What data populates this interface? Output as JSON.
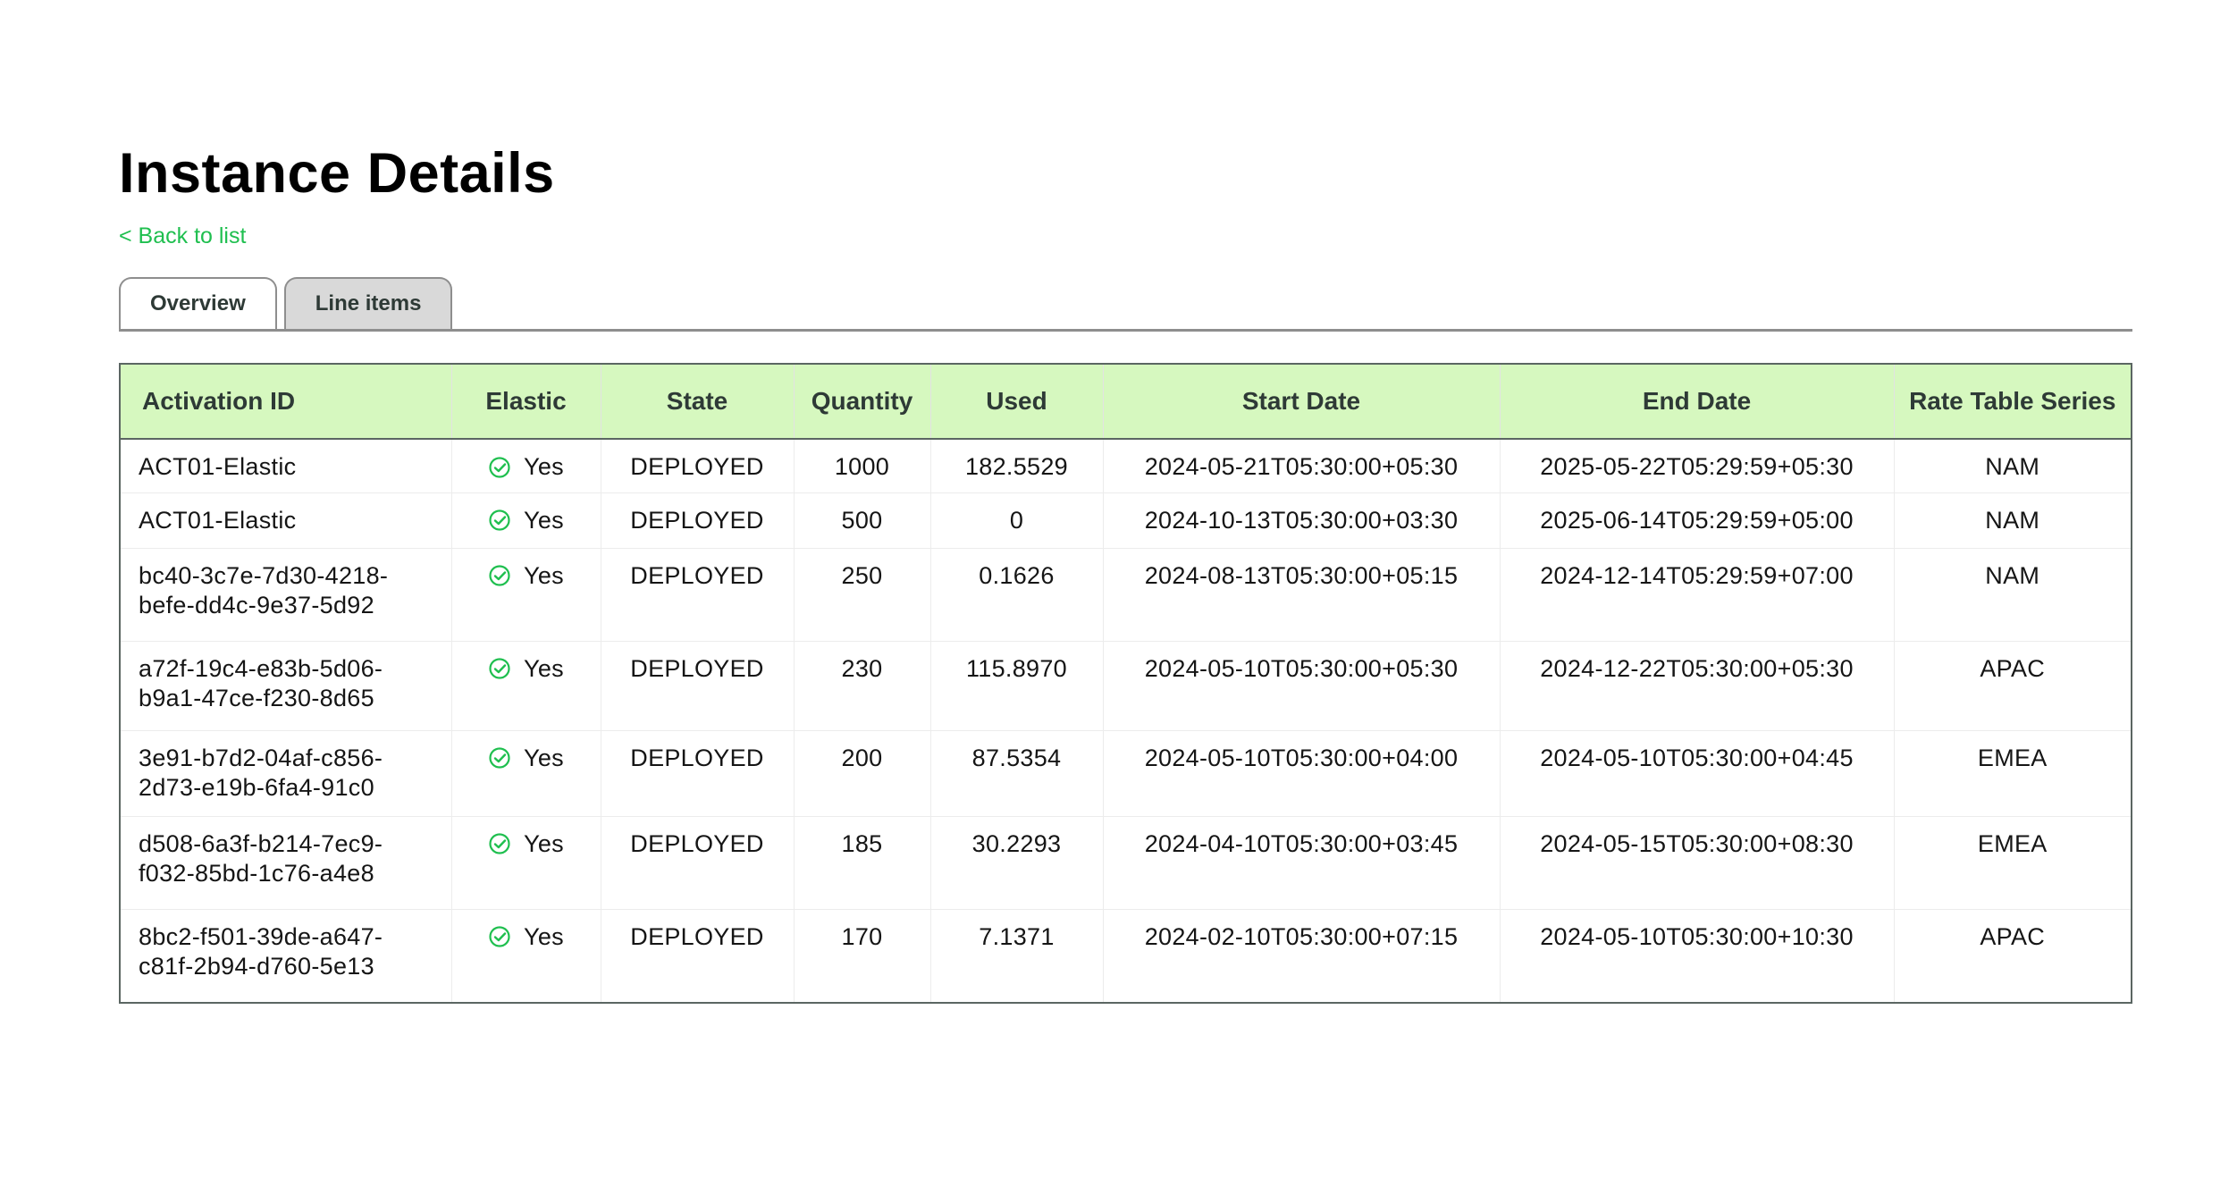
{
  "page": {
    "title": "Instance Details",
    "back_link": "< Back to list"
  },
  "tabs": [
    {
      "label": "Overview"
    },
    {
      "label": "Line items"
    }
  ],
  "table": {
    "columns": [
      "Activation ID",
      "Elastic",
      "State",
      "Quantity",
      "Used",
      "Start Date",
      "End Date",
      "Rate Table Series"
    ],
    "rows": [
      {
        "activation_id_1": "ACT01-Elastic",
        "activation_id_2": "",
        "elastic": "Yes",
        "state": "DEPLOYED",
        "quantity": "1000",
        "used": "182.5529",
        "start_date": "2024-05-21T05:30:00+05:30",
        "end_date": "2025-05-22T05:29:59+05:30",
        "rate_table_series": "NAM"
      },
      {
        "activation_id_1": "ACT01-Elastic",
        "activation_id_2": "",
        "elastic": "Yes",
        "state": "DEPLOYED",
        "quantity": "500",
        "used": "0",
        "start_date": "2024-10-13T05:30:00+03:30",
        "end_date": "2025-06-14T05:29:59+05:00",
        "rate_table_series": "NAM"
      },
      {
        "activation_id_1": "bc40-3c7e-7d30-4218-",
        "activation_id_2": "befe-dd4c-9e37-5d92",
        "elastic": "Yes",
        "state": "DEPLOYED",
        "quantity": "250",
        "used": "0.1626",
        "start_date": "2024-08-13T05:30:00+05:15",
        "end_date": "2024-12-14T05:29:59+07:00",
        "rate_table_series": "NAM"
      },
      {
        "activation_id_1": "a72f-19c4-e83b-5d06-",
        "activation_id_2": "b9a1-47ce-f230-8d65",
        "elastic": "Yes",
        "state": "DEPLOYED",
        "quantity": "230",
        "used": "115.8970",
        "start_date": "2024-05-10T05:30:00+05:30",
        "end_date": "2024-12-22T05:30:00+05:30",
        "rate_table_series": "APAC"
      },
      {
        "activation_id_1": "3e91-b7d2-04af-c856-",
        "activation_id_2": "2d73-e19b-6fa4-91c0",
        "elastic": "Yes",
        "state": "DEPLOYED",
        "quantity": "200",
        "used": "87.5354",
        "start_date": "2024-05-10T05:30:00+04:00",
        "end_date": "2024-05-10T05:30:00+04:45",
        "rate_table_series": "EMEA"
      },
      {
        "activation_id_1": "d508-6a3f-b214-7ec9-",
        "activation_id_2": "f032-85bd-1c76-a4e8",
        "elastic": "Yes",
        "state": "DEPLOYED",
        "quantity": "185",
        "used": "30.2293",
        "start_date": "2024-04-10T05:30:00+03:45",
        "end_date": "2024-05-15T05:30:00+08:30",
        "rate_table_series": "EMEA"
      },
      {
        "activation_id_1": "8bc2-f501-39de-a647-",
        "activation_id_2": "c81f-2b94-d760-5e13",
        "elastic": "Yes",
        "state": "DEPLOYED",
        "quantity": "170",
        "used": "7.1371",
        "start_date": "2024-02-10T05:30:00+07:15",
        "end_date": "2024-05-10T05:30:00+10:30",
        "rate_table_series": "APAC"
      }
    ]
  },
  "colors": {
    "accent_green": "#1fbf4f",
    "header_bg": "#d6f8bf",
    "tab_inactive_bg": "#d9d9d9"
  },
  "icons": {
    "elastic_check": "check-circle-icon"
  }
}
